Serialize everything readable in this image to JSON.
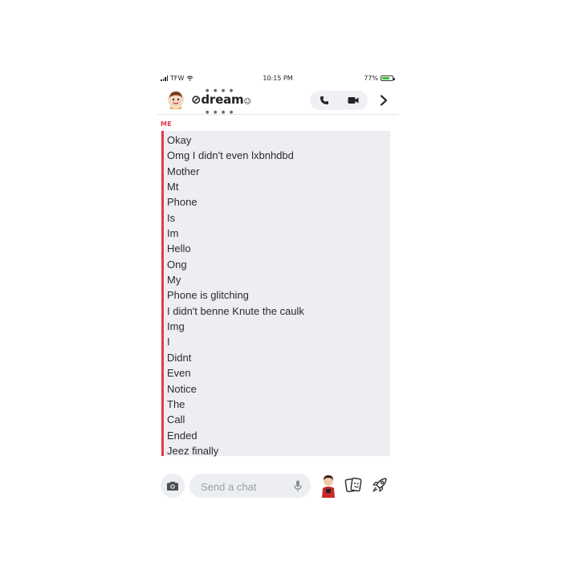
{
  "status_bar": {
    "carrier": "TFW",
    "time": "10:15 PM",
    "battery_percent": "77%",
    "battery_level": 0.77
  },
  "header": {
    "contact_name": "dream",
    "avatar_icon": "bitmoji-avatar-icon",
    "call_icon": "phone-icon",
    "video_icon": "video-camera-icon",
    "more_icon": "chevron-right-icon"
  },
  "conversation": {
    "sender_label": "ME",
    "accent_color": "#e03a4e",
    "messages": [
      "Okay",
      "Omg I didn't even lxbnhdbd",
      "Mother",
      "Mt",
      "Phone",
      "Is",
      "Im",
      "Hello",
      "Ong",
      "My",
      "Phone is glitching",
      "I didn't benne Knute the caulk",
      "Img",
      "I",
      "Didnt",
      "Even",
      "Notice",
      "The",
      "Call",
      "Ended",
      "Jeez finally"
    ]
  },
  "composer": {
    "placeholder": "Send a chat",
    "camera_icon": "camera-icon",
    "mic_icon": "microphone-icon",
    "bitmoji_icon": "bitmoji-icon",
    "stickers_icon": "stickers-icon",
    "rocket_icon": "rocket-icon"
  }
}
